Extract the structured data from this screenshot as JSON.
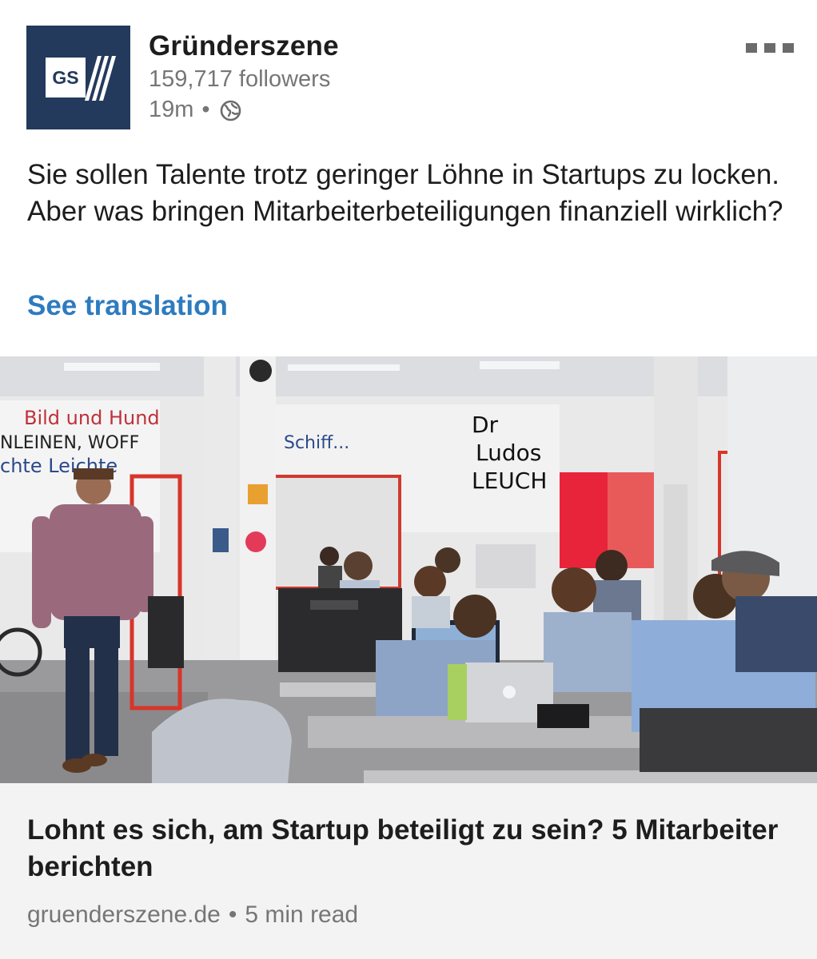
{
  "post": {
    "author": {
      "name": "Gründerszene",
      "followers": "159,717 followers",
      "age": "19m",
      "separator": "•",
      "visibility_icon": "globe-icon",
      "logo_text": "GS"
    },
    "text": "Sie sollen Talente trotz geringer Löhne in Startups zu locken. Aber was bringen Mitarbeiterbeteiligungen finanziell wirklich?",
    "see_translation_label": "See translation",
    "more_icon": "more-options-icon"
  },
  "article": {
    "title": "Lohnt es sich, am Startup beteiligt zu sein? 5 Mitarbeiter berichten",
    "source": "gruenderszene.de",
    "separator": "•",
    "read_time": "5 min read"
  },
  "colors": {
    "brand_navy": "#233a5c",
    "link_blue": "#2e7bbf",
    "secondary_text": "#767676",
    "card_background": "#f3f3f3"
  }
}
